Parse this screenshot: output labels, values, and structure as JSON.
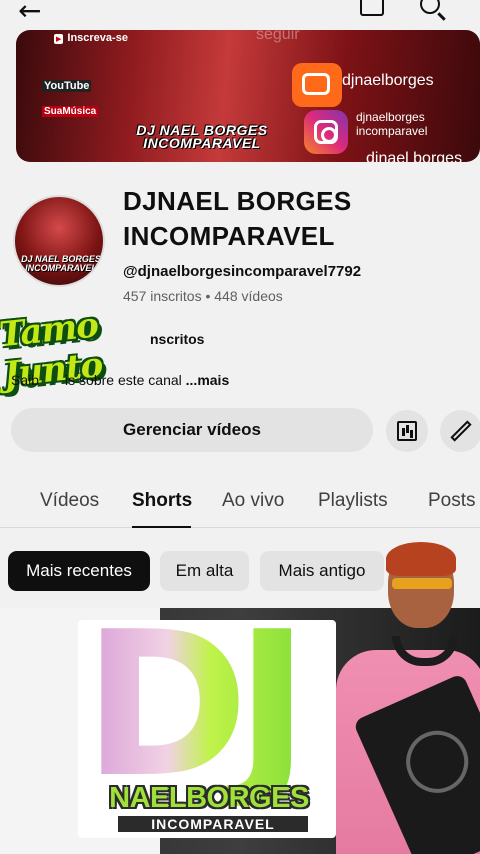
{
  "banner": {
    "subscribe_tag": "Inscreva-se",
    "seguir": "seguir",
    "youtube": "YouTube",
    "suamusica": "SuaMúsica",
    "logo_text": "DJ NAEL BORGES INCOMPARAVEL",
    "social": [
      "djnaelborges",
      "djnaelborges incomparavel",
      "djnael borges"
    ]
  },
  "channel": {
    "name": "DJNAEL BORGES INCOMPARAVEL",
    "avatar_text": "DJ NAEL BORGES INCOMPARAVEL",
    "handle": "@djnaelborgesincomparavel7792",
    "stats": "457 inscritos • 448 vídeos",
    "inscritos_fragment": "nscritos",
    "about_prefix": "Saib",
    "about_rest": "is sobre este canal ",
    "about_more": "...mais"
  },
  "sticker": {
    "text": "Tamo Junto"
  },
  "actions": {
    "manage_videos": "Gerenciar vídeos"
  },
  "tabs": [
    "Vídeos",
    "Shorts",
    "Ao vivo",
    "Playlists",
    "Posts"
  ],
  "active_tab": "Shorts",
  "filters": [
    "Mais recentes",
    "Em alta",
    "Mais antigo"
  ],
  "active_filter": "Mais recentes",
  "thumbnail": {
    "big": "DJ",
    "name": "NAELBORGES",
    "sub": "INCOMPARAVEL"
  },
  "colors": {
    "accent_green": "#9fe03a",
    "banner_red": "#8f1b1f",
    "chip_active": "#0f0f0f"
  },
  "icons": [
    "back-arrow-icon",
    "cast-icon",
    "search-icon",
    "analytics-icon",
    "edit-pencil-icon"
  ]
}
